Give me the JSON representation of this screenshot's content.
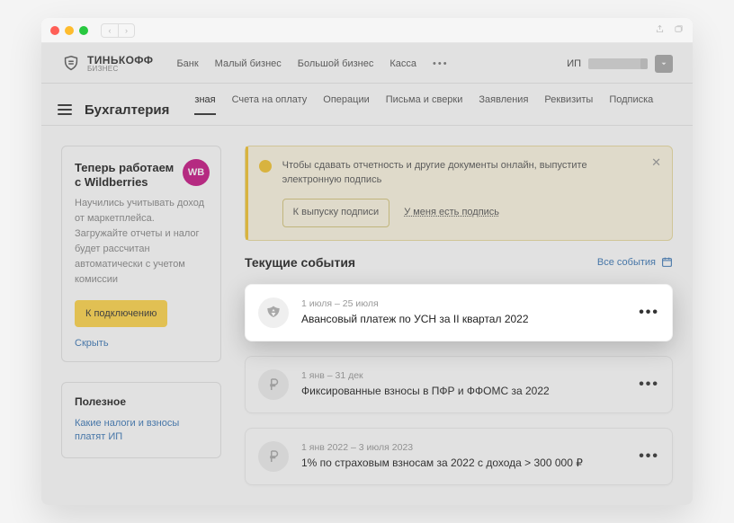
{
  "logo": {
    "line1": "ТИНЬКОФФ",
    "line2": "БИЗНЕС"
  },
  "topnav": {
    "items": [
      "Банк",
      "Малый бизнес",
      "Большой бизнес",
      "Касса"
    ],
    "more": "•••"
  },
  "user": {
    "prefix": "ИП"
  },
  "page": {
    "title": "Бухгалтерия"
  },
  "tabs": [
    "зная",
    "Счета на оплату",
    "Операции",
    "Письма и сверки",
    "Заявления",
    "Реквизиты",
    "Подписка"
  ],
  "wb": {
    "title": "Теперь работаем с Wildberries",
    "badge": "WB",
    "desc": "Научились учитывать доход от маркетплейса. Загружайте отчеты и налог будет рассчитан автоматически с учетом комиссии",
    "button": "К подключению",
    "hide": "Скрыть"
  },
  "useful": {
    "title": "Полезное",
    "links": [
      "Какие налоги и взносы платят ИП"
    ]
  },
  "notice": {
    "text": "Чтобы сдавать отчетность и другие документы онлайн, выпустите электронную подпись",
    "button": "К выпуску подписи",
    "link": "У меня есть подпись"
  },
  "events": {
    "heading": "Текущие события",
    "all": "Все события",
    "items": [
      {
        "date": "1 июля – 25 июля",
        "title": "Авансовый платеж по УСН за II квартал 2022",
        "icon": "eagle"
      },
      {
        "date": "1 янв – 31 дек",
        "title": "Фиксированные взносы в ПФР и ФФОМС за 2022",
        "icon": "ruble"
      },
      {
        "date": "1 янв 2022 – 3 июля 2023",
        "title": "1% по страховым взносам за 2022 с дохода > 300 000 ₽",
        "icon": "ruble"
      }
    ]
  }
}
